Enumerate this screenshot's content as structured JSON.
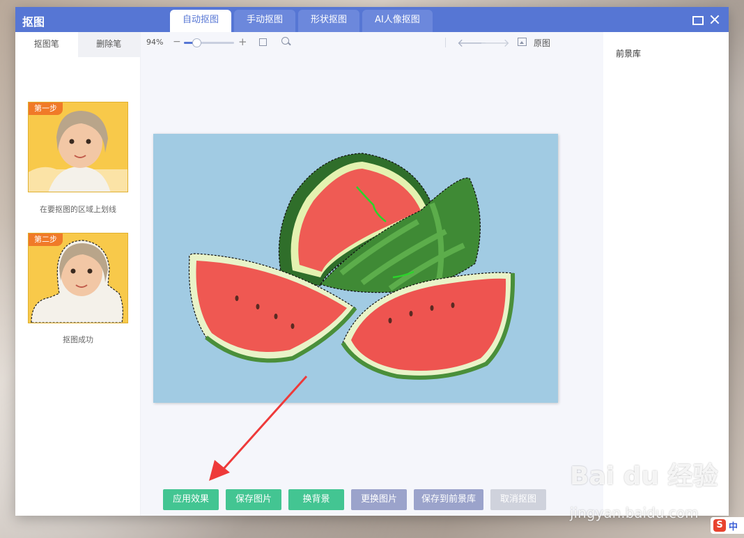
{
  "window": {
    "title": "抠图",
    "tabs": [
      {
        "label": "自动抠图",
        "active": true
      },
      {
        "label": "手动抠图",
        "active": false
      },
      {
        "label": "形状抠图",
        "active": false
      },
      {
        "label": "AI人像抠图",
        "active": false
      }
    ]
  },
  "left_panel": {
    "pen_tabs": [
      "抠图笔",
      "删除笔"
    ],
    "steps": [
      {
        "badge": "第一步",
        "caption": "在要抠图的区域上划线"
      },
      {
        "badge": "第二步",
        "caption": "抠图成功"
      }
    ]
  },
  "toolbar": {
    "zoom": "94%",
    "zoom_minus": "−",
    "zoom_plus": "+",
    "undo_glyph": "🡐",
    "redo_glyph": "🡒",
    "original_label": "原图"
  },
  "buttons": {
    "apply": "应用效果",
    "save_image": "保存图片",
    "change_bg": "换背景",
    "replace_image": "更换图片",
    "save_to_library": "保存到前景库",
    "cancel": "取消抠图"
  },
  "right_panel": {
    "title": "前景库"
  },
  "overlay": {
    "watermark": "Bai du 经验",
    "watermark_url": "jingyan.baidu.com",
    "ime_s": "S",
    "ime_lang": "中"
  },
  "colors": {
    "titlebar": "#5676d4",
    "green_button": "#43c592",
    "purple_button": "#9ba3cb",
    "image_bg": "#a1cbe3"
  }
}
